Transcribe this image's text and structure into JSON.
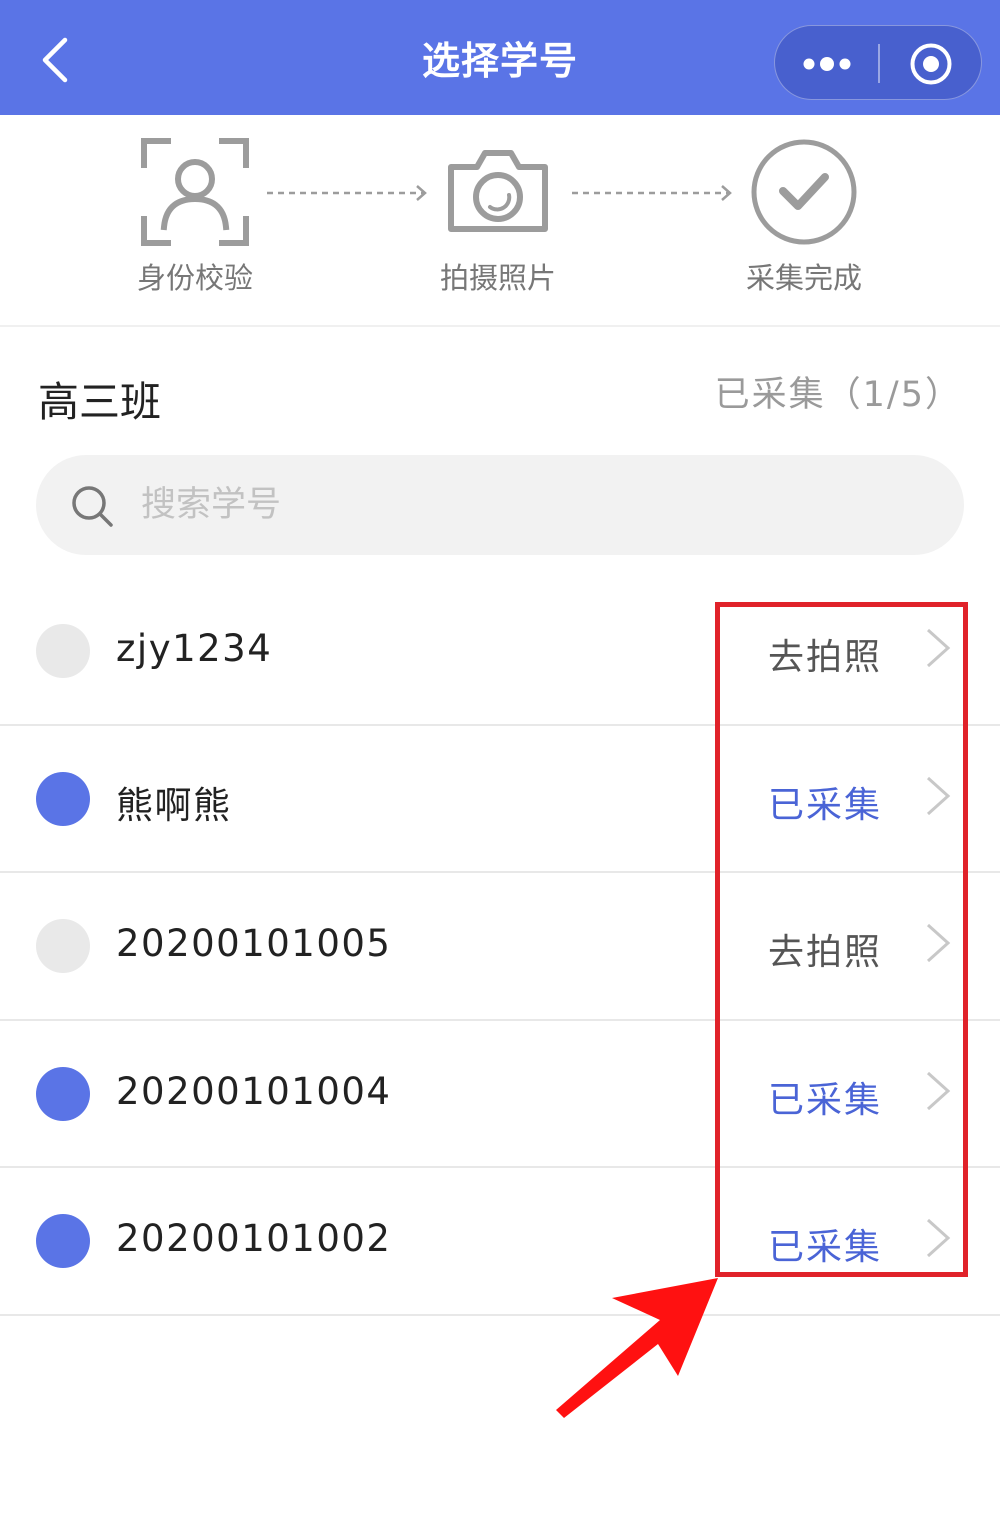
{
  "header": {
    "title": "选择学号",
    "back_icon": "chevron-left-icon",
    "more_icon": "ellipsis-icon",
    "close_icon": "target-circle-icon",
    "bg_color": "#5a74e6"
  },
  "steps": [
    {
      "label": "身份校验",
      "icon": "face-scan-icon"
    },
    {
      "label": "拍摄照片",
      "icon": "camera-icon"
    },
    {
      "label": "采集完成",
      "icon": "check-circle-icon"
    }
  ],
  "class_info": {
    "name": "高三班",
    "collected_text": "已采集（1/5）"
  },
  "search": {
    "placeholder": "搜索学号",
    "value": ""
  },
  "students": [
    {
      "name": "zjy1234",
      "status": "去拍照",
      "state": "pending"
    },
    {
      "name": "熊啊熊",
      "status": "已采集",
      "state": "done"
    },
    {
      "name": "20200101005",
      "status": "去拍照",
      "state": "pending"
    },
    {
      "name": "20200101004",
      "status": "已采集",
      "state": "done"
    },
    {
      "name": "20200101002",
      "status": "已采集",
      "state": "done"
    }
  ],
  "colors": {
    "accent": "#5a74e6",
    "done_text": "#4a64d6",
    "annotation": "#e0222a"
  }
}
